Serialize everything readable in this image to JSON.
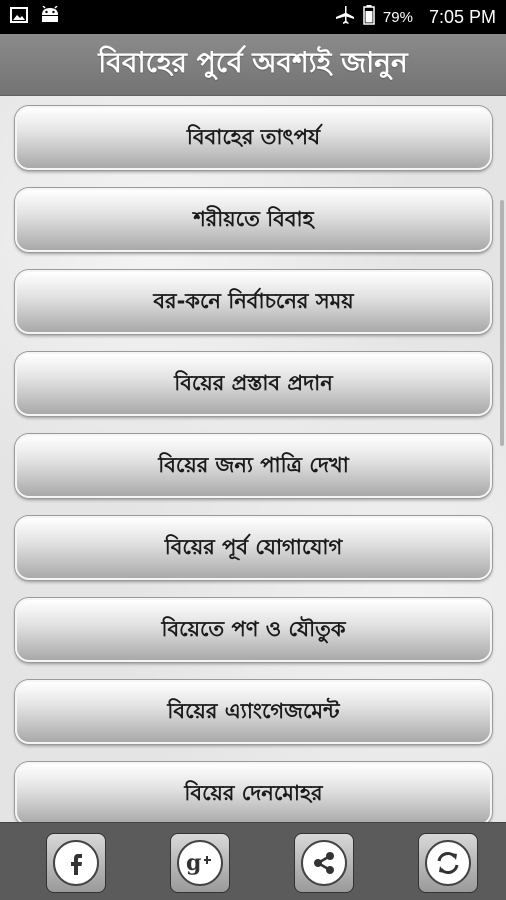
{
  "status_bar": {
    "battery": "79%",
    "time": "7:05 PM",
    "icons": [
      "image-icon",
      "android-icon",
      "airplane-mode-icon",
      "battery-icon"
    ]
  },
  "app_bar": {
    "title": "বিবাহের পুর্বে অবশ্যই জানুন"
  },
  "menu": {
    "items": [
      {
        "label": "বিবাহের তাৎপর্য"
      },
      {
        "label": "শরীয়তে বিবাহ"
      },
      {
        "label": "বর-কনে নির্বাচনের সময়"
      },
      {
        "label": "বিয়ের প্রস্তাব প্রদান"
      },
      {
        "label": "বিয়ের জন্য পাত্রি দেখা"
      },
      {
        "label": "বিয়ের পূর্ব যোগাযোগ"
      },
      {
        "label": "বিয়েতে পণ ও যৌতুক"
      },
      {
        "label": "বিয়ের এ্যাংগেজমেন্ট"
      },
      {
        "label": "বিয়ের দেনমোহর"
      }
    ]
  },
  "bottom_bar": {
    "buttons": [
      "facebook-icon",
      "google-plus-icon",
      "share-icon",
      "refresh-icon"
    ]
  },
  "colors": {
    "app_bar": "#7f7f7f",
    "bottom_bar": "#5b5b5b",
    "button_text": "#1a1a1a"
  }
}
